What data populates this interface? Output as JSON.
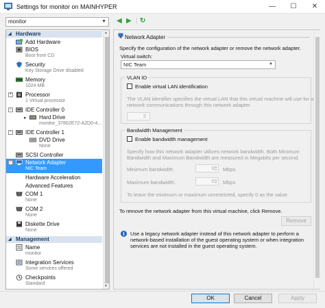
{
  "window": {
    "title": "Settings for monitor on MAINHYPER",
    "minimize_glyph": "—",
    "maximize_glyph": "☐",
    "close_glyph": "✕"
  },
  "vm_selector": {
    "value": "monitor"
  },
  "nav": {
    "back_glyph": "◀",
    "forward_glyph": "▶",
    "refresh_glyph": "↻"
  },
  "tree": {
    "hardware_header": "Hardware",
    "management_header": "Management",
    "hardware_items": [
      {
        "label": "Add Hardware",
        "sub": "",
        "icon": "add-hardware-icon"
      },
      {
        "label": "BIOS",
        "sub": "Boot from CD",
        "icon": "bios-icon"
      },
      {
        "label": "Security",
        "sub": "Key Storage Drive disabled",
        "icon": "security-icon"
      },
      {
        "label": "Memory",
        "sub": "1024 MB",
        "icon": "memory-icon"
      },
      {
        "label": "Processor",
        "sub": "1 Virtual processor",
        "icon": "processor-icon"
      },
      {
        "label": "IDE Controller 0",
        "sub": "",
        "icon": "ide-controller-icon"
      },
      {
        "label": "Hard Drive",
        "sub": "monitor_37862E72-A2D0-4...",
        "icon": "hard-drive-icon"
      },
      {
        "label": "IDE Controller 1",
        "sub": "",
        "icon": "ide-controller-icon"
      },
      {
        "label": "DVD Drive",
        "sub": "None",
        "icon": "dvd-drive-icon"
      },
      {
        "label": "SCSI Controller",
        "sub": "",
        "icon": "scsi-controller-icon"
      },
      {
        "label": "Network Adapter",
        "sub": "NIC Team",
        "icon": "network-adapter-icon"
      },
      {
        "label": "Hardware Acceleration",
        "sub": "",
        "icon": ""
      },
      {
        "label": "Advanced Features",
        "sub": "",
        "icon": ""
      },
      {
        "label": "COM 1",
        "sub": "None",
        "icon": "com-port-icon"
      },
      {
        "label": "COM 2",
        "sub": "None",
        "icon": "com-port-icon"
      },
      {
        "label": "Diskette Drive",
        "sub": "None",
        "icon": "diskette-icon"
      }
    ],
    "management_items": [
      {
        "label": "Name",
        "sub": "monitor",
        "icon": "name-icon"
      },
      {
        "label": "Integration Services",
        "sub": "Some services offered",
        "icon": "integration-services-icon"
      },
      {
        "label": "Checkpoints",
        "sub": "Standard",
        "icon": "checkpoints-icon"
      }
    ]
  },
  "panel": {
    "title": "Network Adapter",
    "description": "Specify the configuration of the network adapter or remove the network adapter.",
    "virtual_switch_label": "Virtual switch:",
    "virtual_switch_value": "NIC Team",
    "vlan": {
      "legend": "VLAN ID",
      "checkbox_label": "Enable virtual LAN identification",
      "help_line1": "The VLAN identifier specifies the virtual LAN that this virtual machine will use for all",
      "help_line2": "network communications through this network adapter.",
      "value": "2"
    },
    "bandwidth": {
      "legend": "Bandwidth Management",
      "checkbox_label": "Enable bandwidth management",
      "help_line1": "Specify how this network adapter utilizes network bandwidth. Both Minimum",
      "help_line2": "Bandwidth and Maximum Bandwidth are measured in Megabits per second.",
      "min_label": "Minimum bandwidth:",
      "min_value": "0",
      "max_label": "Maximum bandwidth:",
      "max_value": "0",
      "unit": "Mbps",
      "zero_line1": "To leave the minimum or maximum unrestricted, specify 0 as the value."
    },
    "remove_text": "To remove the network adapter from this virtual machine, click Remove.",
    "remove_button": "Remove",
    "info_line1": "Use a legacy network adapter instead of this network adapter to perform a",
    "info_line2": "network-based installation of the guest operating system or when integration",
    "info_line3": "services are not installed in the guest operating system."
  },
  "footer": {
    "ok": "OK",
    "cancel": "Cancel",
    "apply": "Apply"
  },
  "colors": {
    "selection": "#3399ff",
    "section_header_bg": "#d9e3ef",
    "info_icon": "#2266bb"
  }
}
